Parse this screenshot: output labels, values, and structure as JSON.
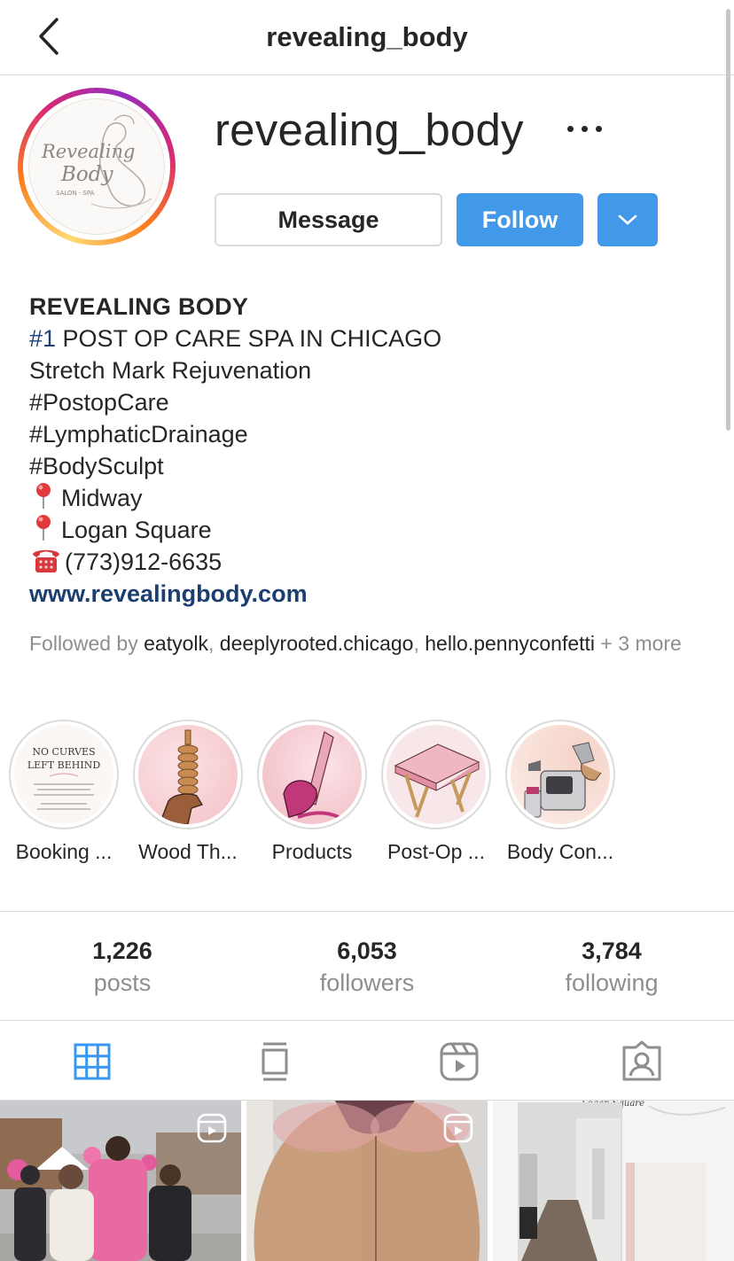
{
  "header": {
    "title": "revealing_body"
  },
  "profile": {
    "username": "revealing_body",
    "avatar_logo_text": [
      "Revealing",
      "Body",
      "SALON · SPA"
    ]
  },
  "actions": {
    "message_label": "Message",
    "follow_label": "Follow"
  },
  "bio": {
    "name": "REVEALING BODY",
    "line1_hash": "#1",
    "line1_rest": " POST OP CARE SPA IN CHICAGO",
    "line2": "Stretch Mark Rejuvenation",
    "line3": "#PostopCare",
    "line4": "#LymphaticDrainage",
    "line5": "#BodySculpt",
    "location1": "Midway",
    "location2": "Logan Square",
    "phone": "(773)912-6635",
    "website": "www.revealingbody.com"
  },
  "followed_by": {
    "prefix": "Followed by ",
    "user1": "eatyolk",
    "sep1": ", ",
    "user2": "deeplyrooted.chicago",
    "sep2": ", ",
    "user3": "hello.pennyconfetti",
    "suffix": " + 3 more"
  },
  "highlights": [
    {
      "label": "Booking ...",
      "cover_text": [
        "NO CURVES",
        "LEFT BEHIND"
      ]
    },
    {
      "label": "Wood Th..."
    },
    {
      "label": "Products"
    },
    {
      "label": "Post-Op ..."
    },
    {
      "label": "Body Con..."
    }
  ],
  "stats": {
    "posts": {
      "value": "1,226",
      "label": "posts"
    },
    "followers": {
      "value": "6,053",
      "label": "followers"
    },
    "following": {
      "value": "3,784",
      "label": "following"
    }
  },
  "tabs": [
    "grid-icon",
    "feed-icon",
    "reels-icon",
    "tagged-icon"
  ],
  "grid_posts": [
    {
      "type": "reel"
    },
    {
      "type": "reel"
    },
    {
      "type": "image",
      "overlay_text": "Logan Square"
    }
  ],
  "colors": {
    "accent": "#4299e9",
    "link": "#1c3e70",
    "muted": "#8e8e8e",
    "border": "#dbdbdb"
  }
}
